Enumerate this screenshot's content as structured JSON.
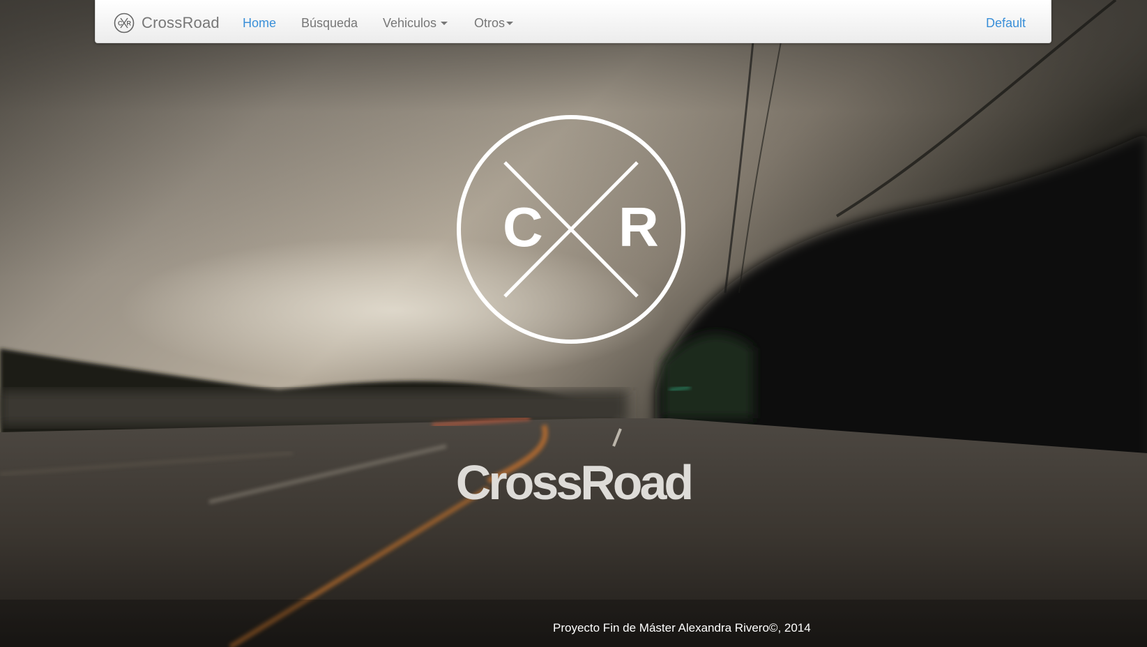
{
  "navbar": {
    "brand": "CrossRoad",
    "items": [
      {
        "label": "Home",
        "active": true
      },
      {
        "label": "Búsqueda"
      },
      {
        "label": "Vehiculos"
      },
      {
        "label": "Otros"
      }
    ],
    "right_label": "Default"
  },
  "hero": {
    "logo_letter_left": "C",
    "logo_letter_right": "R",
    "title": "CrossRoad"
  },
  "footer": {
    "text": "Proyecto Fin de Máster Alexandra Rivero©, 2014"
  },
  "colors": {
    "active_link": "#3a8fd8",
    "nav_text": "#777777",
    "hero_text": "#dedcd8"
  },
  "icons": {
    "brand": "crossroad-logo-icon",
    "dropdown": "caret-down-icon"
  }
}
